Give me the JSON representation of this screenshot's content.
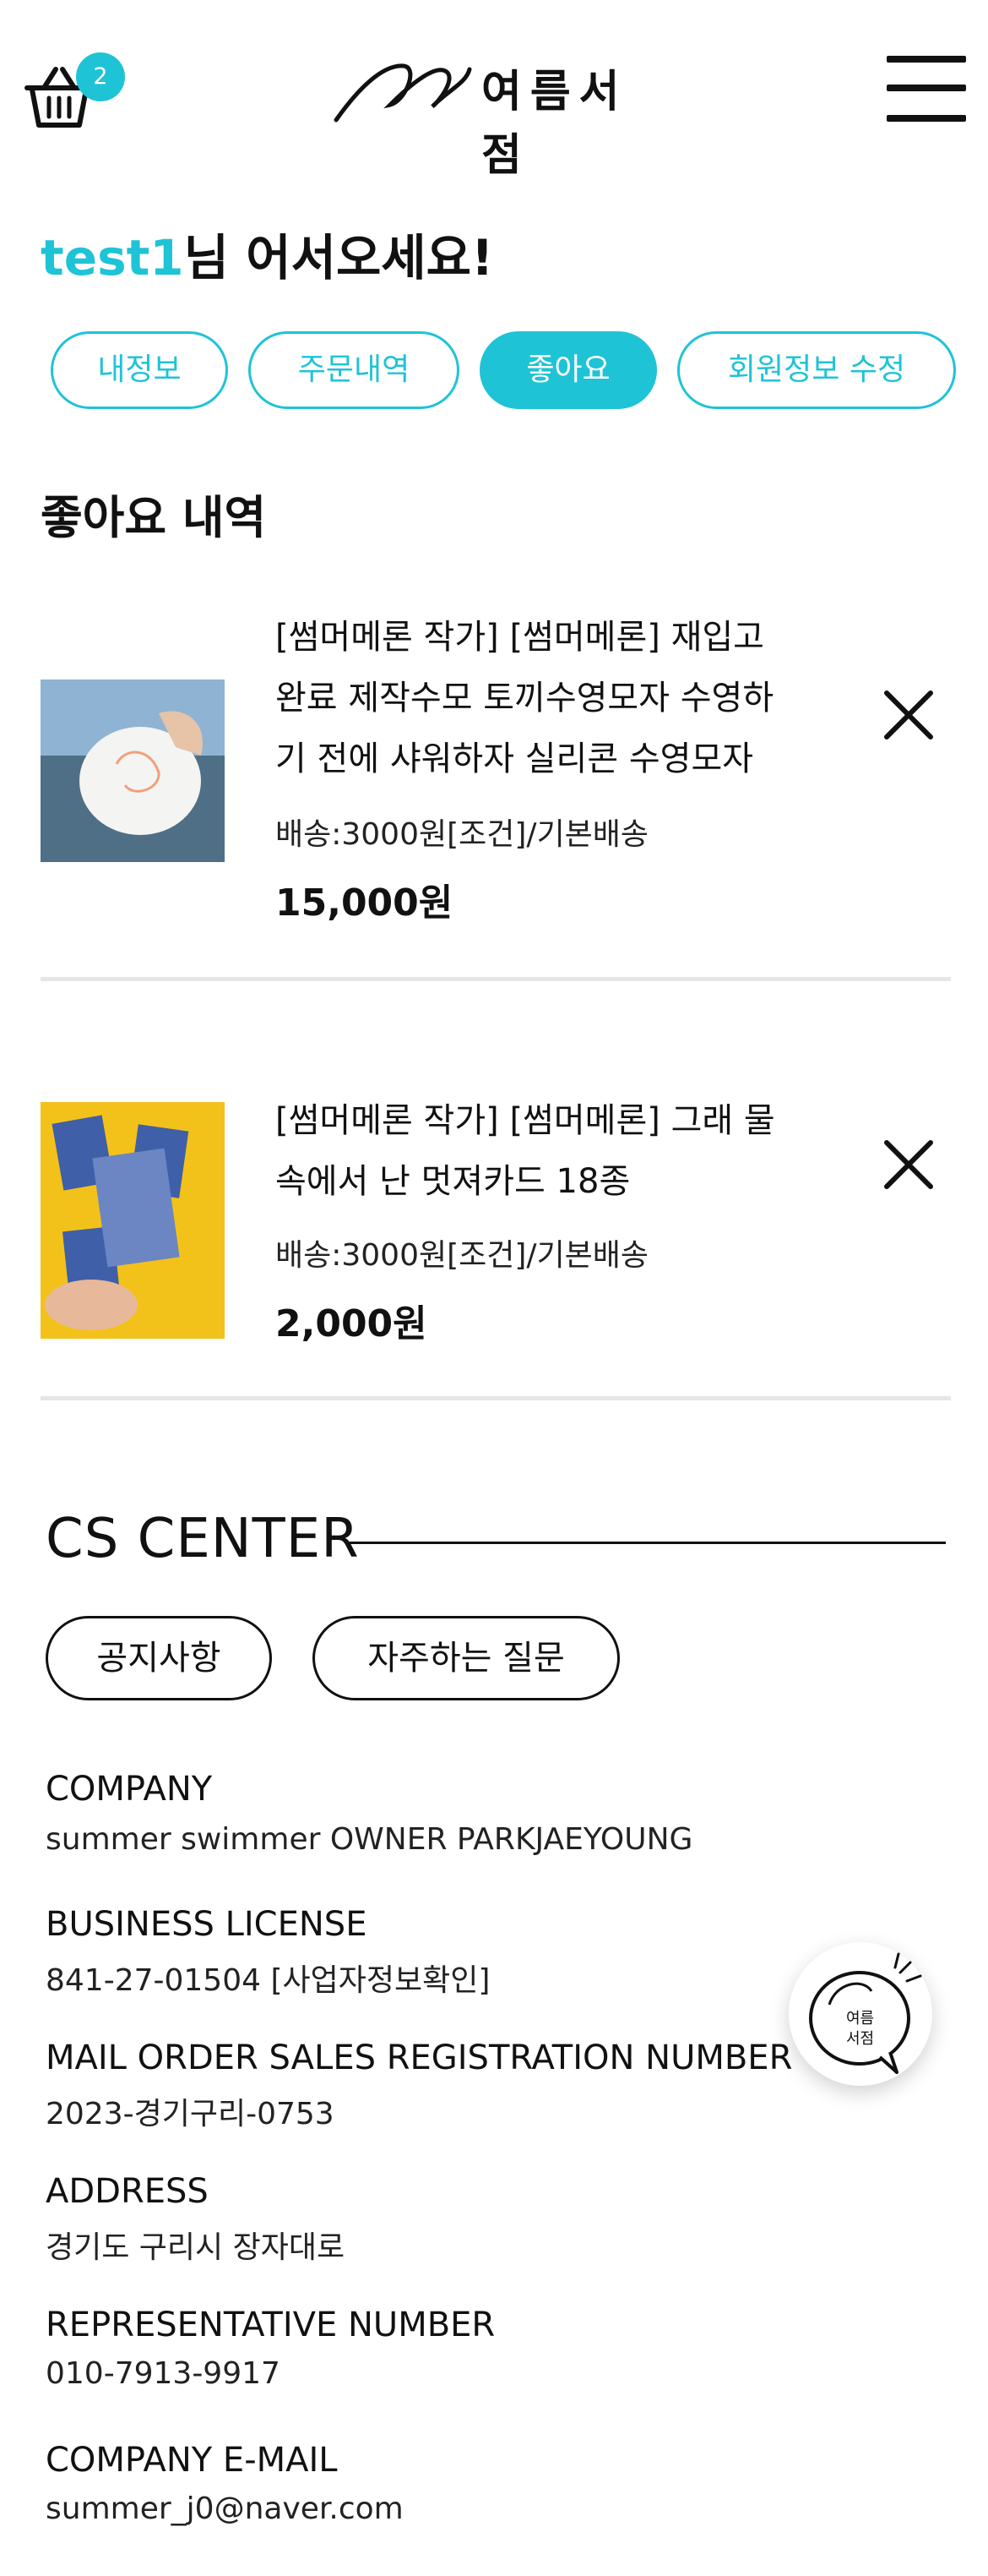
{
  "header": {
    "cart_count": "2",
    "logo_text": "여름서점"
  },
  "welcome": {
    "username": "test1",
    "suffix": "님 어서오세요!"
  },
  "tabs": [
    {
      "label": "내정보"
    },
    {
      "label": "주문내역"
    },
    {
      "label": "좋아요",
      "active": true
    },
    {
      "label": "회원정보 수정"
    }
  ],
  "section_title": "좋아요 내역",
  "items": [
    {
      "title_lines": [
        "[썸머메론 작가] [썸머메론] 재입고",
        "완료 제작수모 토끼수영모자 수영하",
        "기 전에 샤워하자 실리콘 수영모자"
      ],
      "shipping": "배송:3000원[조건]/기본배송",
      "price": "15,000원"
    },
    {
      "title_lines": [
        "[썸머메론 작가] [썸머메론] 그래 물",
        "속에서 난 멋져카드 18종"
      ],
      "shipping": "배송:3000원[조건]/기본배송",
      "price": "2,000원"
    }
  ],
  "cs": {
    "title": "CS CENTER",
    "buttons": [
      "공지사항",
      "자주하는 질문"
    ],
    "info": [
      {
        "label": "COMPANY",
        "value": "summer swimmer OWNER PARKJAEYOUNG"
      },
      {
        "label": "BUSINESS LICENSE",
        "value": "841-27-01504 [사업자정보확인]"
      },
      {
        "label": "MAIL ORDER SALES REGISTRATION NUMBER",
        "value": "2023-경기구리-0753"
      },
      {
        "label": "ADDRESS",
        "value": "경기도 구리시 장자대로"
      },
      {
        "label": "REPRESENTATIVE NUMBER",
        "value": "010-7913-9917"
      },
      {
        "label": "COMPANY E-MAIL",
        "value": "summer_j0@naver.com"
      }
    ]
  },
  "chat_button": {
    "label_line1": "여름",
    "label_line2": "서점"
  },
  "colors": {
    "accent": "#1fc3d6",
    "text": "#111111",
    "divider": "#e6e6e6"
  }
}
